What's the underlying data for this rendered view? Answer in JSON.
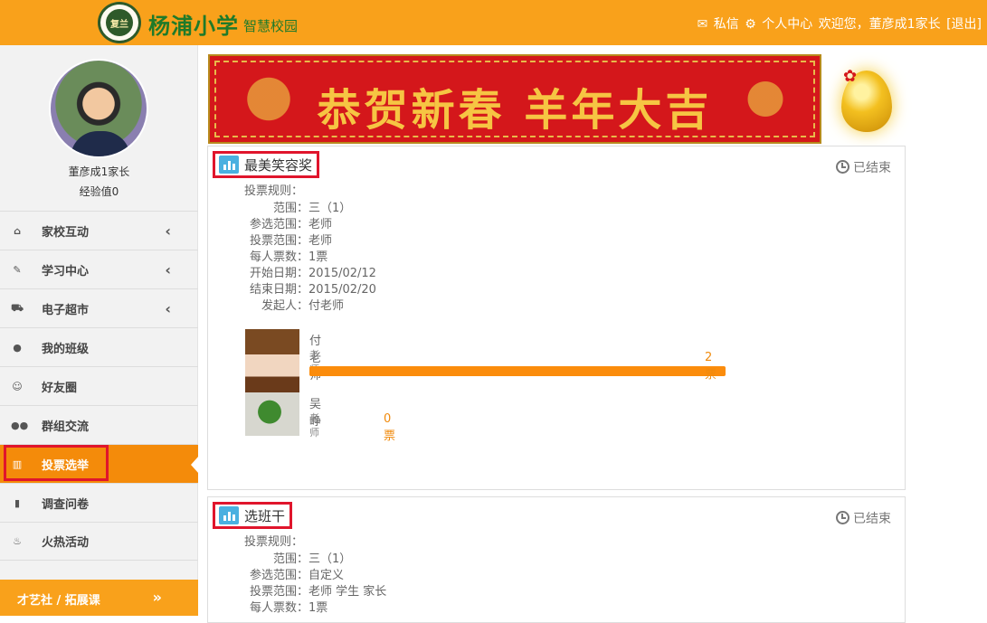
{
  "header": {
    "seal_text": "复兰",
    "title": "杨浦小学",
    "subtitle": "智慧校园",
    "messages_label": "私信",
    "profile_label": "个人中心",
    "welcome": "欢迎您，董彦成1家长",
    "logout": "[退出]",
    "colors": {
      "bar": "#f9a11b",
      "logo_green": "#1f7a2a"
    }
  },
  "sidebar": {
    "user_name": "董彦成1家长",
    "experience": "经验值0",
    "items": [
      {
        "label": "家校互动",
        "icon": "home-icon",
        "has_submenu": true
      },
      {
        "label": "学习中心",
        "icon": "edit-icon",
        "has_submenu": true
      },
      {
        "label": "电子超市",
        "icon": "cart-icon",
        "has_submenu": true
      },
      {
        "label": "我的班级",
        "icon": "user-icon",
        "has_submenu": false
      },
      {
        "label": "好友圈",
        "icon": "smile-icon",
        "has_submenu": false
      },
      {
        "label": "群组交流",
        "icon": "group-icon",
        "has_submenu": false
      },
      {
        "label": "投票选举",
        "icon": "bar-chart-icon",
        "has_submenu": false,
        "active": true
      },
      {
        "label": "调查问卷",
        "icon": "document-icon",
        "has_submenu": false
      },
      {
        "label": "火热活动",
        "icon": "fire-icon",
        "has_submenu": false
      }
    ],
    "extra_link": "才艺社 / 拓展课",
    "active_color": "#f48b0a"
  },
  "banner": {
    "text": "恭贺新春 羊年大吉"
  },
  "polls": [
    {
      "title": "最美笑容奖",
      "status": "已结束",
      "rule_label": "投票规则：",
      "fields": [
        {
          "label": "范围：",
          "value": "三（1）"
        },
        {
          "label": "参选范围：",
          "value": "老师"
        },
        {
          "label": "投票范围：",
          "value": "老师"
        },
        {
          "label": "每人票数：",
          "value": "1票"
        },
        {
          "label": "开始日期：",
          "value": "2015/02/12"
        },
        {
          "label": "结束日期：",
          "value": "2015/02/20"
        },
        {
          "label": "发起人：",
          "value": "付老师"
        }
      ],
      "candidates": [
        {
          "name": "付老师",
          "role": "老师",
          "votes": "2票",
          "share": 1.0
        },
        {
          "name": "吴峥",
          "role": "老师",
          "votes": "0票",
          "share": 0.0
        }
      ]
    },
    {
      "title": "选班干",
      "status": "已结束",
      "rule_label": "投票规则：",
      "fields": [
        {
          "label": "范围：",
          "value": "三（1）"
        },
        {
          "label": "参选范围：",
          "value": "自定义"
        },
        {
          "label": "投票范围：",
          "value": "老师 学生 家长"
        },
        {
          "label": "每人票数：",
          "value": "1票"
        }
      ]
    }
  ]
}
